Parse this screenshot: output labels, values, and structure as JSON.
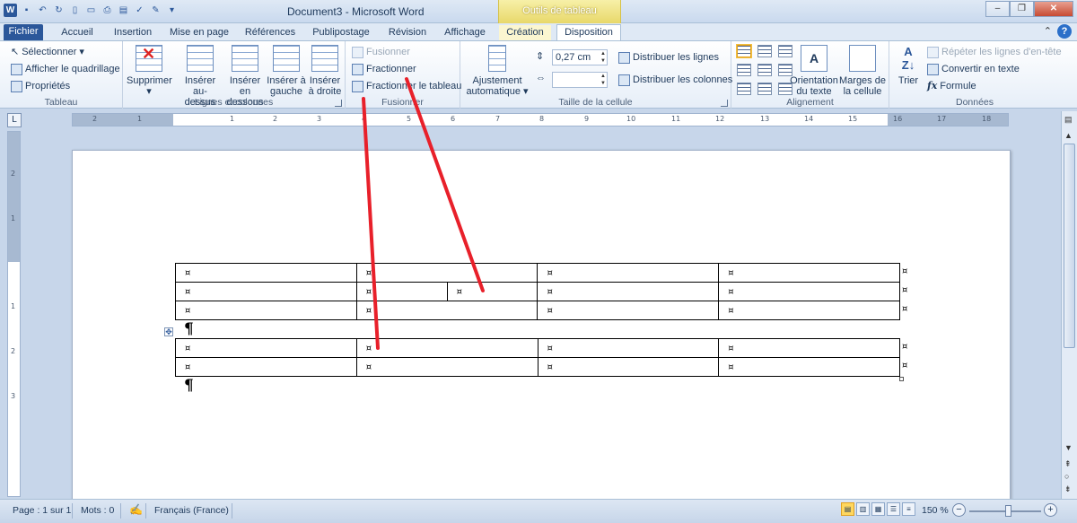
{
  "app": {
    "title": "Document3  -  Microsoft Word",
    "context_tab": "Outils de tableau"
  },
  "tabs": [
    {
      "label": "Fichier"
    },
    {
      "label": "Accueil"
    },
    {
      "label": "Insertion"
    },
    {
      "label": "Mise en page"
    },
    {
      "label": "Références"
    },
    {
      "label": "Publipostage"
    },
    {
      "label": "Révision"
    },
    {
      "label": "Affichage"
    },
    {
      "label": "Création"
    },
    {
      "label": "Disposition"
    }
  ],
  "ribbon": {
    "tableau": {
      "label": "Tableau",
      "items": [
        "Sélectionner ▾",
        "Afficher le quadrillage",
        "Propriétés"
      ]
    },
    "lignes_colonnes": {
      "label": "Lignes et colonnes",
      "supprimer": "Supprimer",
      "inserer_dessus_1": "Insérer",
      "inserer_dessus_2": "au-dessus",
      "inserer_dessous_1": "Insérer en",
      "inserer_dessous_2": "dessous",
      "inserer_gauche_1": "Insérer à",
      "inserer_gauche_2": "gauche",
      "inserer_droite_1": "Insérer",
      "inserer_droite_2": "à droite"
    },
    "fusionner": {
      "label": "Fusionner",
      "fusionner": "Fusionner",
      "fractionner": "Fractionner",
      "fractionner_tableau": "Fractionner le tableau"
    },
    "taille": {
      "label": "Taille de la cellule",
      "ajustement_1": "Ajustement",
      "ajustement_2": "automatique ▾",
      "height_value": "0,27 cm",
      "width_value": "",
      "distribuer_lignes": "Distribuer les lignes",
      "distribuer_colonnes": "Distribuer les colonnes"
    },
    "alignement": {
      "label": "Alignement",
      "orientation_1": "Orientation",
      "orientation_2": "du texte",
      "marges_1": "Marges de",
      "marges_2": "la cellule"
    },
    "donnees": {
      "label": "Données",
      "trier": "Trier",
      "repeter": "Répéter les lignes d'en-tête",
      "convertir": "Convertir en texte",
      "formule": "Formule"
    }
  },
  "ruler": {
    "h_numbers": [
      "2",
      "1",
      "1",
      "2",
      "3",
      "4",
      "5",
      "6",
      "7",
      "8",
      "9",
      "10",
      "11",
      "12",
      "13",
      "14",
      "15",
      "16",
      "17",
      "18"
    ],
    "v_numbers": [
      "2",
      "1",
      "1",
      "2",
      "3"
    ]
  },
  "document": {
    "cell_marker": "¤",
    "pilcrow": "¶"
  },
  "status": {
    "page": "Page : 1 sur 1",
    "words": "Mots : 0",
    "language": "Français (France)",
    "zoom": "150 %"
  },
  "annotation_color": "#e8202a"
}
